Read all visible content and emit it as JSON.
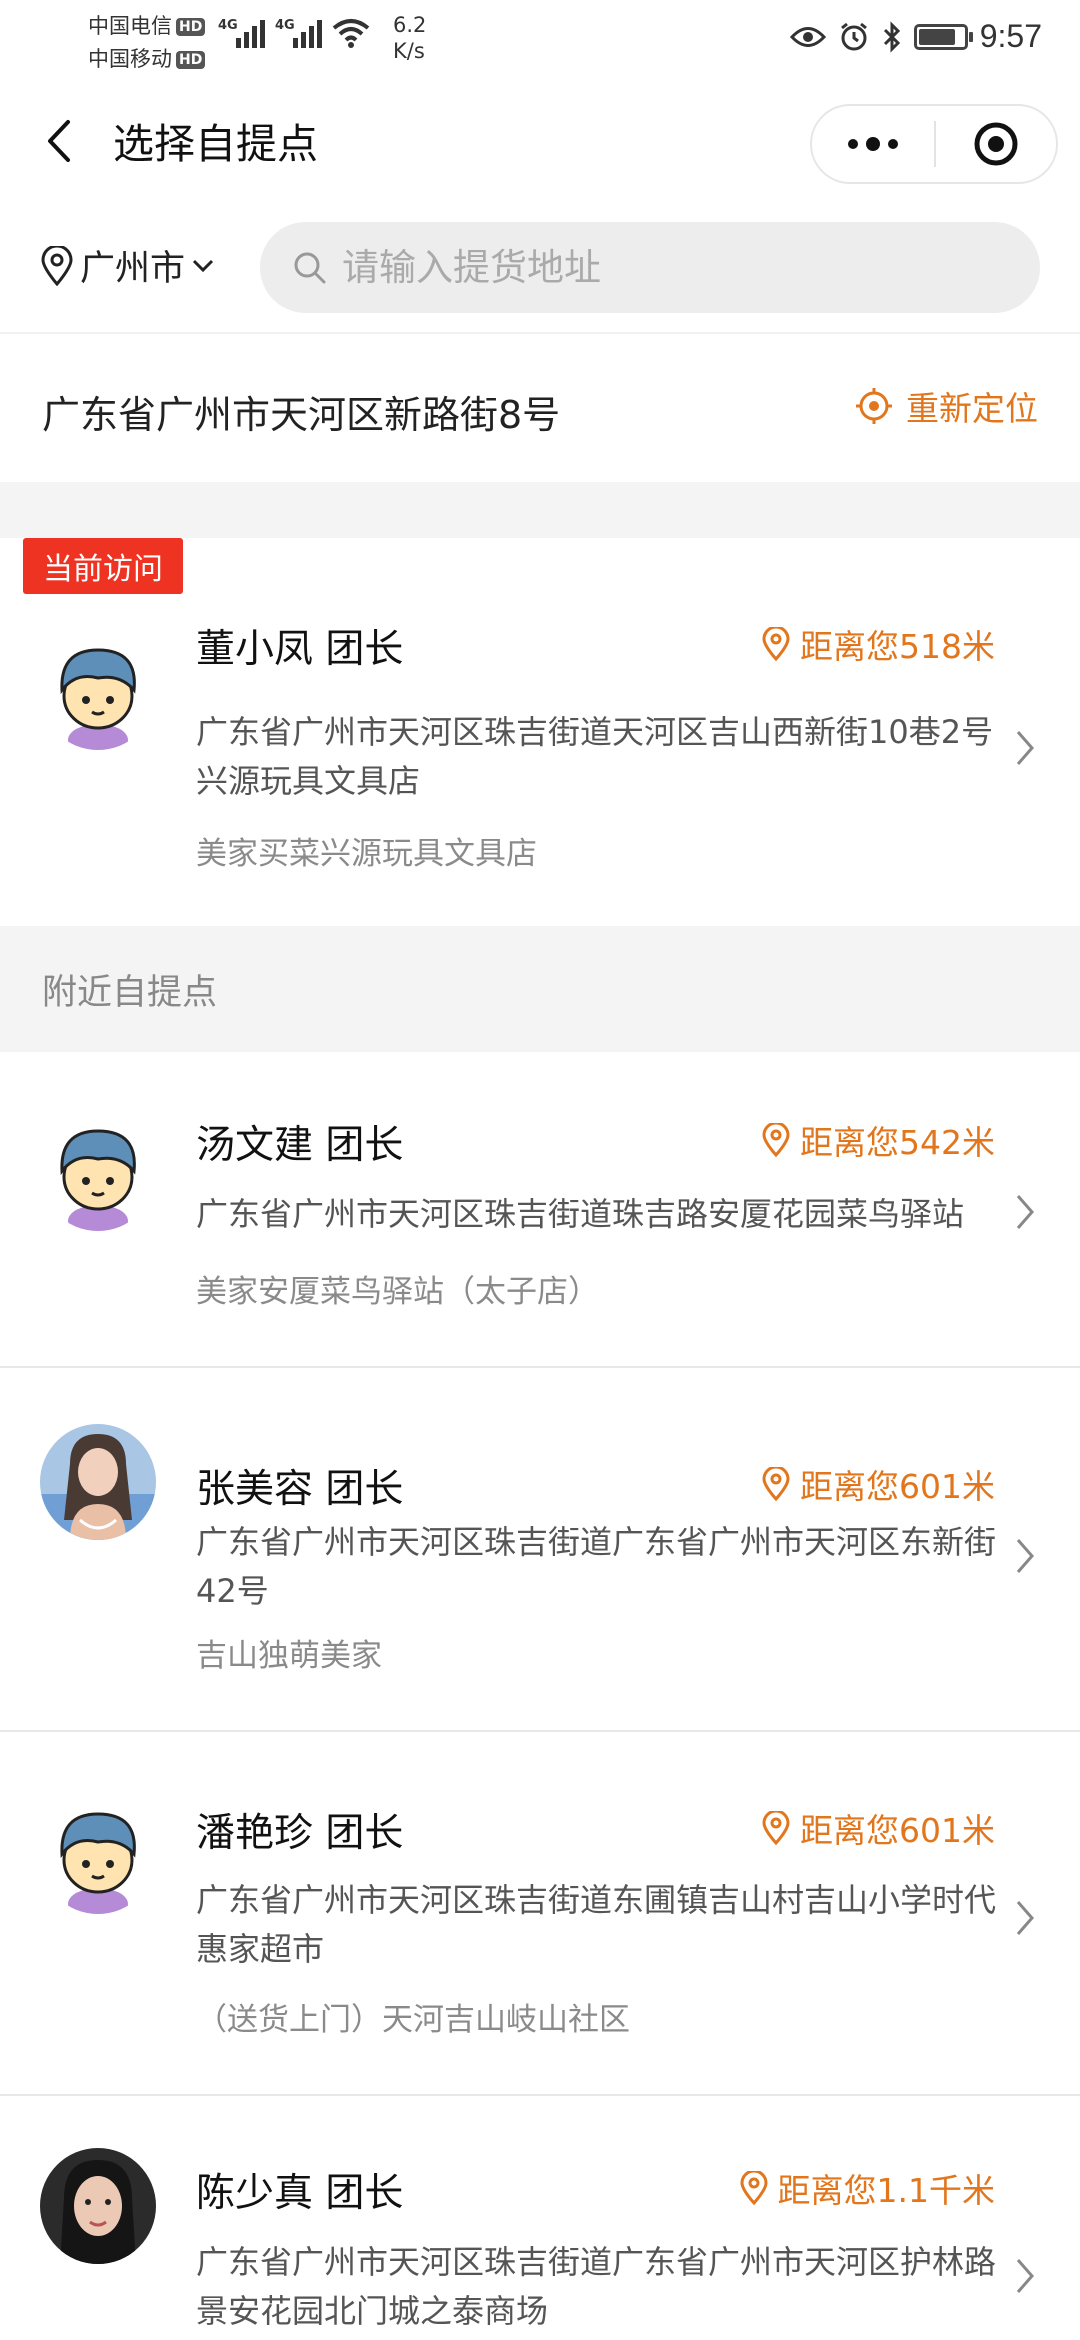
{
  "status_bar": {
    "carrier1": "中国电信",
    "carrier2": "中国移动",
    "hd": "HD",
    "net_label": "4G",
    "speed_value": "6.2",
    "speed_unit": "K/s",
    "time": "9:57"
  },
  "nav": {
    "title": "选择自提点"
  },
  "search": {
    "city": "广州市",
    "placeholder": "请输入提货地址"
  },
  "location": {
    "address": "广东省广州市天河区新路街8号",
    "relocate_label": "重新定位"
  },
  "current": {
    "tag": "当前访问",
    "name": "董小凤 团长",
    "distance": "距离您518米",
    "address": "广东省广州市天河区珠吉街道天河区吉山西新街10巷2号兴源玩具文具店",
    "shop": "美家买菜兴源玩具文具店"
  },
  "nearby": {
    "title": "附近自提点",
    "items": [
      {
        "name": "汤文建 团长",
        "distance": "距离您542米",
        "address": "广东省广州市天河区珠吉街道珠吉路安厦花园菜鸟驿站",
        "shop": "美家安厦菜鸟驿站（太子店）"
      },
      {
        "name": "张美容 团长",
        "distance": "距离您601米",
        "address": "广东省广州市天河区珠吉街道广东省广州市天河区东新街42号",
        "shop": "吉山独萌美家"
      },
      {
        "name": "潘艳珍 团长",
        "distance": "距离您601米",
        "address": "广东省广州市天河区珠吉街道东圃镇吉山村吉山小学时代惠家超市",
        "shop": "（送货上门）天河吉山岐山社区"
      },
      {
        "name": "陈少真 团长",
        "distance": "距离您1.1千米",
        "address": "广东省广州市天河区珠吉街道广东省广州市天河区护林路景安花园北门城之泰商场",
        "shop": ""
      }
    ]
  },
  "colors": {
    "accent": "#e2761c",
    "tag_red": "#ee3322",
    "band_gray": "#f4f4f4"
  }
}
